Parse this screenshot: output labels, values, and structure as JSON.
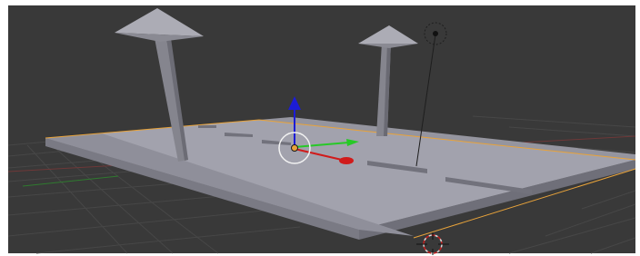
{
  "viewport": {
    "mode": "3D View",
    "background_color": "#393939",
    "frame_color": "#ffffff"
  },
  "scene": {
    "objects": [
      {
        "kind": "plane",
        "name_shown": "",
        "selected": true,
        "outline_color": "#e8a33a"
      },
      {
        "kind": "lamp-post",
        "name_shown": ""
      },
      {
        "kind": "lamp-post",
        "name_shown": ""
      },
      {
        "kind": "lamp",
        "name_shown": ""
      }
    ],
    "colors": {
      "road_top": "#9d9da9",
      "sidewalk": "#8d8d98",
      "lane_marking": "#707078",
      "pole": "#8a8a92",
      "grid_line": "#4a4a4a",
      "x_axis": "#7a3a3a",
      "y_axis": "#2f6a2f"
    }
  },
  "gizmo": {
    "x_color": "#d11b1b",
    "y_color": "#27c927",
    "z_color": "#1c1cd6",
    "ring_color": "#ffffff",
    "origin_color": "#e8a33a"
  },
  "icons": [
    "lamp-target-icon",
    "3d-cursor-icon",
    "transform-gizmo-icon"
  ]
}
